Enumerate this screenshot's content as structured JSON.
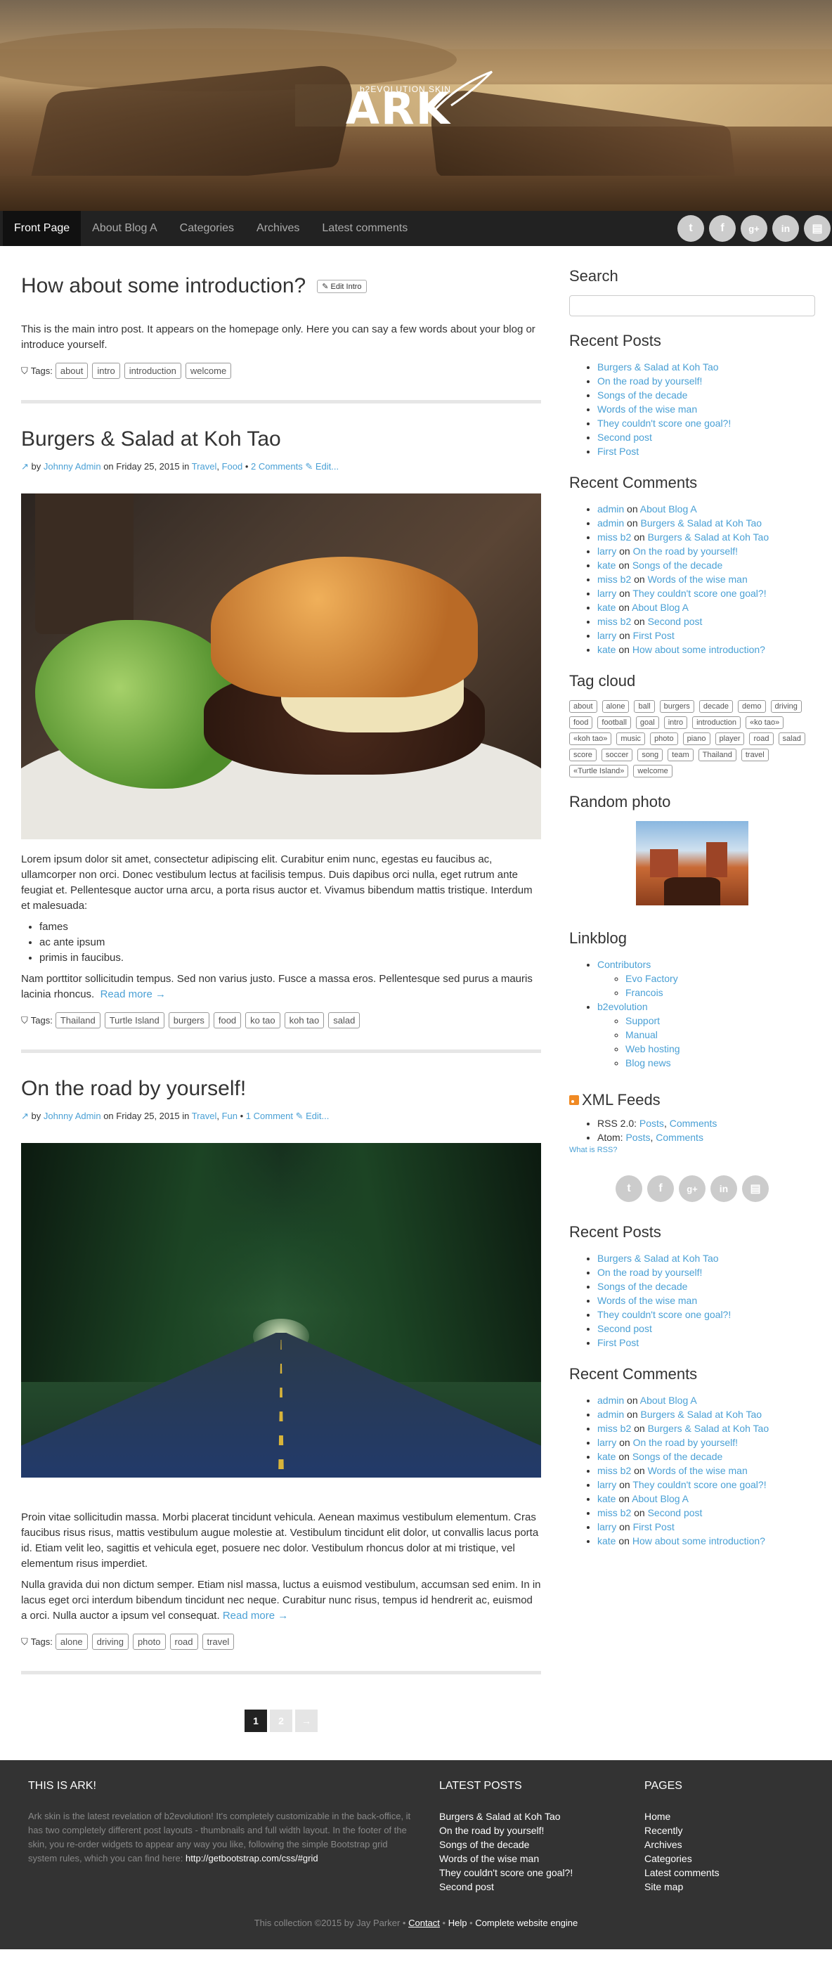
{
  "header": {
    "logo_sub": "b2EVOLUTION SKIN",
    "logo_title": "ARK"
  },
  "nav": {
    "items": [
      "Front Page",
      "About Blog A",
      "Categories",
      "Archives",
      "Latest comments"
    ]
  },
  "social": [
    "t",
    "f",
    "g+",
    "in",
    "▤"
  ],
  "intro": {
    "title": "How about some introduction?",
    "edit": "Edit Intro",
    "text": "This is the main intro post. It appears on the homepage only. Here you can say a few words about your blog or introduce yourself.",
    "tags_label": "Tags:",
    "tags": [
      "about",
      "intro",
      "introduction",
      "welcome"
    ]
  },
  "posts": [
    {
      "title": "Burgers & Salad at Koh Tao",
      "by": "by",
      "author": "Johnny Admin",
      "on": "on Friday 25, 2015 in",
      "cat1": "Travel",
      "cat2": "Food",
      "comments": "2 Comments",
      "edit": "Edit...",
      "p1": "Lorem ipsum dolor sit amet, consectetur adipiscing elit. Curabitur enim nunc, egestas eu faucibus ac, ullamcorper non orci. Donec vestibulum lectus at facilisis tempus. Duis dapibus orci nulla, eget rutrum ante feugiat et. Pellentesque auctor urna arcu, a porta risus auctor et. Vivamus bibendum mattis tristique. Interdum et malesuada:",
      "list": [
        "fames",
        "ac ante ipsum",
        "primis in faucibus."
      ],
      "p2": "Nam porttitor sollicitudin tempus. Sed non varius justo. Fusce a massa eros. Pellentesque sed purus a mauris lacinia rhoncus.",
      "more": "Read more →",
      "tags": [
        "Thailand",
        "Turtle Island",
        "burgers",
        "food",
        "ko tao",
        "koh tao",
        "salad"
      ]
    },
    {
      "title": "On the road by yourself!",
      "by": "by",
      "author": "Johnny Admin",
      "on": "on Friday 25, 2015 in",
      "cat1": "Travel",
      "cat2": "Fun",
      "comments": "1 Comment",
      "edit": "Edit...",
      "p1": "Proin vitae sollicitudin massa. Morbi placerat tincidunt vehicula. Aenean maximus vestibulum elementum. Cras faucibus risus risus, mattis vestibulum augue molestie at. Vestibulum tincidunt elit dolor, ut convallis lacus porta id. Etiam velit leo, sagittis et vehicula eget, posuere nec dolor. Vestibulum rhoncus dolor at mi tristique, vel elementum risus imperdiet.",
      "p2": "Nulla gravida dui non dictum semper. Etiam nisl massa, luctus a euismod vestibulum, accumsan sed enim. In in lacus eget orci interdum bibendum tincidunt nec neque. Curabitur nunc risus, tempus id hendrerit ac, euismod a orci. Nulla auctor a ipsum vel consequat.",
      "more": "Read more →",
      "tags": [
        "alone",
        "driving",
        "photo",
        "road",
        "travel"
      ]
    }
  ],
  "pager": {
    "current": "1",
    "next": "2",
    "arrow": "→"
  },
  "sidebar": {
    "search_title": "Search",
    "recent_posts_title": "Recent Posts",
    "recent_posts": [
      "Burgers & Salad at Koh Tao",
      "On the road by yourself!",
      "Songs of the decade",
      "Words of the wise man",
      "They couldn't score one goal?!",
      "Second post",
      "First Post"
    ],
    "recent_comments_title": "Recent Comments",
    "recent_comments": [
      {
        "who": "admin",
        "on": "on",
        "post": "About Blog A"
      },
      {
        "who": "admin",
        "on": "on",
        "post": "Burgers & Salad at Koh Tao"
      },
      {
        "who": "miss b2",
        "on": "on",
        "post": "Burgers & Salad at Koh Tao"
      },
      {
        "who": "larry",
        "on": "on",
        "post": "On the road by yourself!"
      },
      {
        "who": "kate",
        "on": "on",
        "post": "Songs of the decade"
      },
      {
        "who": "miss b2",
        "on": "on",
        "post": "Words of the wise man"
      },
      {
        "who": "larry",
        "on": "on",
        "post": "They couldn't score one goal?!"
      },
      {
        "who": "kate",
        "on": "on",
        "post": "About Blog A"
      },
      {
        "who": "miss b2",
        "on": "on",
        "post": "Second post"
      },
      {
        "who": "larry",
        "on": "on",
        "post": "First Post"
      },
      {
        "who": "kate",
        "on": "on",
        "post": "How about some introduction?"
      }
    ],
    "tagcloud_title": "Tag cloud",
    "tagcloud": [
      "about",
      "alone",
      "ball",
      "burgers",
      "decade",
      "demo",
      "driving",
      "food",
      "football",
      "goal",
      "intro",
      "introduction",
      "«ko tao»",
      "«koh tao»",
      "music",
      "photo",
      "piano",
      "player",
      "road",
      "salad",
      "score",
      "soccer",
      "song",
      "team",
      "Thailand",
      "travel",
      "«Turtle Island»",
      "welcome"
    ],
    "random_photo_title": "Random photo",
    "linkblog_title": "Linkblog",
    "linkblog": [
      {
        "name": "Contributors",
        "children": [
          "Evo Factory",
          "Francois"
        ]
      },
      {
        "name": "b2evolution",
        "children": [
          "Support",
          "Manual",
          "Web hosting",
          "Blog news"
        ]
      }
    ],
    "xml_title": "XML Feeds",
    "rss_label": "RSS 2.0:",
    "atom_label": "Atom:",
    "posts": "Posts",
    "comments": "Comments",
    "what_rss": "What is RSS?"
  },
  "footer": {
    "col1_title": "THIS IS ARK!",
    "col1_text": "Ark skin is the latest revelation of b2evolution! It's completely customizable in the back-office, it has two completely different post layouts - thumbnails and full width layout. In the footer of the skin, you re-order widgets to appear any way you like, following the simple Bootstrap grid system rules, which you can find here:",
    "col1_link": "http://getbootstrap.com/css/#grid",
    "col2_title": "LATEST POSTS",
    "col2_items": [
      "Burgers & Salad at Koh Tao",
      "On the road by yourself!",
      "Songs of the decade",
      "Words of the wise man",
      "They couldn't score one goal?!",
      "Second post"
    ],
    "col3_title": "PAGES",
    "col3_items": [
      "Home",
      "Recently",
      "Archives",
      "Categories",
      "Latest comments",
      "Site map"
    ],
    "copyright": "This collection ©2015 by Jay Parker",
    "contact": "Contact",
    "help": "Help",
    "engine": "Complete website engine",
    "dot": "•"
  }
}
